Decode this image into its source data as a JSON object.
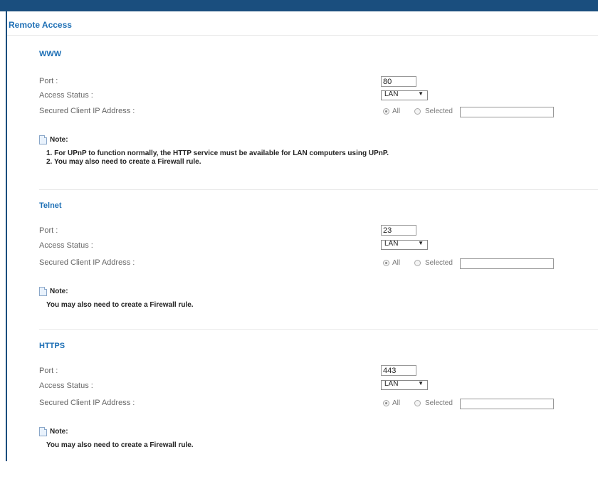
{
  "page": {
    "title": "Remote Access"
  },
  "labels": {
    "port": "Port :",
    "access_status": "Access Status :",
    "secured_ip": "Secured Client IP Address :",
    "all": "All",
    "selected": "Selected",
    "note": "Note:"
  },
  "sections": [
    {
      "title": "WWW",
      "port": "80",
      "access_status": "LAN",
      "secured_ip_mode": "All",
      "secured_ip_value": "",
      "notes": [
        "1. For UPnP to function normally, the HTTP service must be available for LAN computers using UPnP.",
        "2. You may also need to create a Firewall rule."
      ]
    },
    {
      "title": "Telnet",
      "port": "23",
      "access_status": "LAN",
      "secured_ip_mode": "All",
      "secured_ip_value": "",
      "notes": [
        "You may also need to create a Firewall rule."
      ]
    },
    {
      "title": "HTTPS",
      "port": "443",
      "access_status": "LAN",
      "secured_ip_mode": "All",
      "secured_ip_value": "",
      "notes": [
        "You may also need to create a Firewall rule."
      ]
    }
  ]
}
